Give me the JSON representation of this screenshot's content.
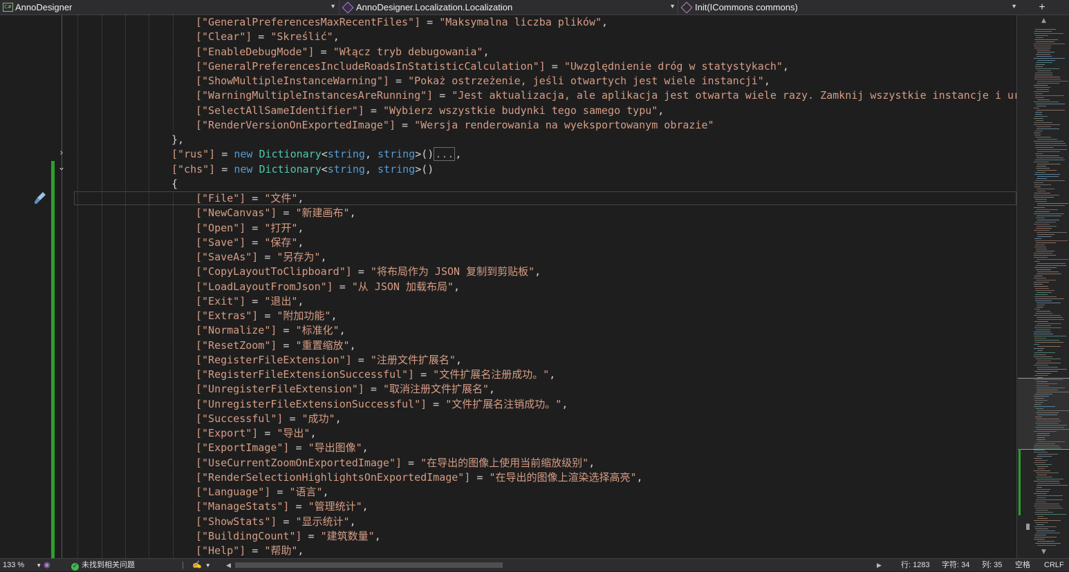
{
  "navbar": {
    "project": "AnnoDesigner",
    "project_badge": "C#",
    "type": "AnnoDesigner.Localization.Localization",
    "member": "Init(ICommons commons)",
    "split_icon": "plus-icon"
  },
  "editor": {
    "code_lines": [
      {
        "indent": 283,
        "parts": [
          [
            "s",
            "[\"GeneralPreferencesMaxRecentFiles\"]"
          ],
          [
            "p",
            " = "
          ],
          [
            "s",
            "\"Maksymalna liczba plików\""
          ],
          [
            "p",
            ","
          ]
        ]
      },
      {
        "indent": 283,
        "parts": [
          [
            "s",
            "[\"Clear\"]"
          ],
          [
            "p",
            " = "
          ],
          [
            "s",
            "\"Skreślić\""
          ],
          [
            "p",
            ","
          ]
        ]
      },
      {
        "indent": 283,
        "parts": [
          [
            "s",
            "[\"EnableDebugMode\"]"
          ],
          [
            "p",
            " = "
          ],
          [
            "s",
            "\"Włącz tryb debugowania\""
          ],
          [
            "p",
            ","
          ]
        ]
      },
      {
        "indent": 283,
        "parts": [
          [
            "s",
            "[\"GeneralPreferencesIncludeRoadsInStatisticCalculation\"]"
          ],
          [
            "p",
            " = "
          ],
          [
            "s",
            "\"Uwzględnienie dróg w statystykach\""
          ],
          [
            "p",
            ","
          ]
        ]
      },
      {
        "indent": 283,
        "parts": [
          [
            "s",
            "[\"ShowMultipleInstanceWarning\"]"
          ],
          [
            "p",
            " = "
          ],
          [
            "s",
            "\"Pokaż ostrzeżenie, jeśli otwartych jest wiele instancji\""
          ],
          [
            "p",
            ","
          ]
        ]
      },
      {
        "indent": 283,
        "parts": [
          [
            "s",
            "[\"WarningMultipleInstancesAreRunning\"]"
          ],
          [
            "p",
            " = "
          ],
          [
            "s",
            "\"Jest aktualizacja, ale aplikacja jest otwarta wiele razy. Zamknij wszystkie instancje i uruchom"
          ]
        ]
      },
      {
        "indent": 283,
        "parts": [
          [
            "s",
            "[\"SelectAllSameIdentifier\"]"
          ],
          [
            "p",
            " = "
          ],
          [
            "s",
            "\"Wybierz wszystkie budynki tego samego typu\""
          ],
          [
            "p",
            ","
          ]
        ]
      },
      {
        "indent": 283,
        "parts": [
          [
            "s",
            "[\"RenderVersionOnExportedImage\"]"
          ],
          [
            "p",
            " = "
          ],
          [
            "s",
            "\"Wersja renderowania na wyeksportowanym obrazie\""
          ]
        ]
      },
      {
        "indent": 248,
        "parts": [
          [
            "p",
            "},"
          ]
        ]
      },
      {
        "indent": 248,
        "parts": [
          [
            "s",
            "[\"rus\"]"
          ],
          [
            "p",
            " = "
          ],
          [
            "k",
            "new"
          ],
          [
            "p",
            " "
          ],
          [
            "t",
            "Dictionary"
          ],
          [
            "p",
            "<"
          ],
          [
            "k",
            "string"
          ],
          [
            "p",
            ", "
          ],
          [
            "k",
            "string"
          ],
          [
            "p",
            ">()"
          ],
          [
            "c",
            "..."
          ],
          [
            "p",
            ","
          ]
        ]
      },
      {
        "indent": 248,
        "parts": [
          [
            "s",
            "[\"chs\"]"
          ],
          [
            "p",
            " = "
          ],
          [
            "k",
            "new"
          ],
          [
            "p",
            " "
          ],
          [
            "t",
            "Dictionary"
          ],
          [
            "p",
            "<"
          ],
          [
            "k",
            "string"
          ],
          [
            "p",
            ", "
          ],
          [
            "k",
            "string"
          ],
          [
            "p",
            ">()"
          ]
        ]
      },
      {
        "indent": 248,
        "parts": [
          [
            "p",
            "{"
          ]
        ]
      },
      {
        "indent": 283,
        "parts": [
          [
            "s",
            "[\"File\"]"
          ],
          [
            "p",
            " = "
          ],
          [
            "s",
            "\"文件\""
          ],
          [
            "p",
            ","
          ]
        ]
      },
      {
        "indent": 283,
        "parts": [
          [
            "s",
            "[\"NewCanvas\"]"
          ],
          [
            "p",
            " = "
          ],
          [
            "s",
            "\"新建画布\""
          ],
          [
            "p",
            ","
          ]
        ]
      },
      {
        "indent": 283,
        "parts": [
          [
            "s",
            "[\"Open\"]"
          ],
          [
            "p",
            " = "
          ],
          [
            "s",
            "\"打开\""
          ],
          [
            "p",
            ","
          ]
        ]
      },
      {
        "indent": 283,
        "parts": [
          [
            "s",
            "[\"Save\"]"
          ],
          [
            "p",
            " = "
          ],
          [
            "s",
            "\"保存\""
          ],
          [
            "p",
            ","
          ]
        ]
      },
      {
        "indent": 283,
        "parts": [
          [
            "s",
            "[\"SaveAs\"]"
          ],
          [
            "p",
            " = "
          ],
          [
            "s",
            "\"另存为\""
          ],
          [
            "p",
            ","
          ]
        ]
      },
      {
        "indent": 283,
        "parts": [
          [
            "s",
            "[\"CopyLayoutToClipboard\"]"
          ],
          [
            "p",
            " = "
          ],
          [
            "s",
            "\"将布局作为 JSON 复制到剪贴板\""
          ],
          [
            "p",
            ","
          ]
        ]
      },
      {
        "indent": 283,
        "parts": [
          [
            "s",
            "[\"LoadLayoutFromJson\"]"
          ],
          [
            "p",
            " = "
          ],
          [
            "s",
            "\"从 JSON 加载布局\""
          ],
          [
            "p",
            ","
          ]
        ]
      },
      {
        "indent": 283,
        "parts": [
          [
            "s",
            "[\"Exit\"]"
          ],
          [
            "p",
            " = "
          ],
          [
            "s",
            "\"退出\""
          ],
          [
            "p",
            ","
          ]
        ]
      },
      {
        "indent": 283,
        "parts": [
          [
            "s",
            "[\"Extras\"]"
          ],
          [
            "p",
            " = "
          ],
          [
            "s",
            "\"附加功能\""
          ],
          [
            "p",
            ","
          ]
        ]
      },
      {
        "indent": 283,
        "parts": [
          [
            "s",
            "[\"Normalize\"]"
          ],
          [
            "p",
            " = "
          ],
          [
            "s",
            "\"标准化\""
          ],
          [
            "p",
            ","
          ]
        ]
      },
      {
        "indent": 283,
        "parts": [
          [
            "s",
            "[\"ResetZoom\"]"
          ],
          [
            "p",
            " = "
          ],
          [
            "s",
            "\"重置缩放\""
          ],
          [
            "p",
            ","
          ]
        ]
      },
      {
        "indent": 283,
        "parts": [
          [
            "s",
            "[\"RegisterFileExtension\"]"
          ],
          [
            "p",
            " = "
          ],
          [
            "s",
            "\"注册文件扩展名\""
          ],
          [
            "p",
            ","
          ]
        ]
      },
      {
        "indent": 283,
        "parts": [
          [
            "s",
            "[\"RegisterFileExtensionSuccessful\"]"
          ],
          [
            "p",
            " = "
          ],
          [
            "s",
            "\"文件扩展名注册成功。\""
          ],
          [
            "p",
            ","
          ]
        ]
      },
      {
        "indent": 283,
        "parts": [
          [
            "s",
            "[\"UnregisterFileExtension\"]"
          ],
          [
            "p",
            " = "
          ],
          [
            "s",
            "\"取消注册文件扩展名\""
          ],
          [
            "p",
            ","
          ]
        ]
      },
      {
        "indent": 283,
        "parts": [
          [
            "s",
            "[\"UnregisterFileExtensionSuccessful\"]"
          ],
          [
            "p",
            " = "
          ],
          [
            "s",
            "\"文件扩展名注销成功。\""
          ],
          [
            "p",
            ","
          ]
        ]
      },
      {
        "indent": 283,
        "parts": [
          [
            "s",
            "[\"Successful\"]"
          ],
          [
            "p",
            " = "
          ],
          [
            "s",
            "\"成功\""
          ],
          [
            "p",
            ","
          ]
        ]
      },
      {
        "indent": 283,
        "parts": [
          [
            "s",
            "[\"Export\"]"
          ],
          [
            "p",
            " = "
          ],
          [
            "s",
            "\"导出\""
          ],
          [
            "p",
            ","
          ]
        ]
      },
      {
        "indent": 283,
        "parts": [
          [
            "s",
            "[\"ExportImage\"]"
          ],
          [
            "p",
            " = "
          ],
          [
            "s",
            "\"导出图像\""
          ],
          [
            "p",
            ","
          ]
        ]
      },
      {
        "indent": 283,
        "parts": [
          [
            "s",
            "[\"UseCurrentZoomOnExportedImage\"]"
          ],
          [
            "p",
            " = "
          ],
          [
            "s",
            "\"在导出的图像上使用当前缩放级别\""
          ],
          [
            "p",
            ","
          ]
        ]
      },
      {
        "indent": 283,
        "parts": [
          [
            "s",
            "[\"RenderSelectionHighlightsOnExportedImage\"]"
          ],
          [
            "p",
            " = "
          ],
          [
            "s",
            "\"在导出的图像上渲染选择高亮\""
          ],
          [
            "p",
            ","
          ]
        ]
      },
      {
        "indent": 283,
        "parts": [
          [
            "s",
            "[\"Language\"]"
          ],
          [
            "p",
            " = "
          ],
          [
            "s",
            "\"语言\""
          ],
          [
            "p",
            ","
          ]
        ]
      },
      {
        "indent": 283,
        "parts": [
          [
            "s",
            "[\"ManageStats\"]"
          ],
          [
            "p",
            " = "
          ],
          [
            "s",
            "\"管理统计\""
          ],
          [
            "p",
            ","
          ]
        ]
      },
      {
        "indent": 283,
        "parts": [
          [
            "s",
            "[\"ShowStats\"]"
          ],
          [
            "p",
            " = "
          ],
          [
            "s",
            "\"显示统计\""
          ],
          [
            "p",
            ","
          ]
        ]
      },
      {
        "indent": 283,
        "parts": [
          [
            "s",
            "[\"BuildingCount\"]"
          ],
          [
            "p",
            " = "
          ],
          [
            "s",
            "\"建筑数量\""
          ],
          [
            "p",
            ","
          ]
        ]
      },
      {
        "indent": 283,
        "parts": [
          [
            "s",
            "[\"Help\"]"
          ],
          [
            "p",
            " = "
          ],
          [
            "s",
            "\"帮助\""
          ],
          [
            "p",
            ","
          ]
        ]
      }
    ]
  },
  "colors": {
    "string": "#d69d85",
    "keyword": "#569cd6",
    "type": "#4ec9b0",
    "plain": "#d4d4d4",
    "changed": "#2aa22a"
  },
  "statusbar": {
    "zoom": "133 %",
    "issues": "未找到相关问题",
    "line": "行: 1283",
    "char": "字符: 34",
    "col": "列: 35",
    "whitespace": "空格",
    "eol": "CRLF"
  }
}
